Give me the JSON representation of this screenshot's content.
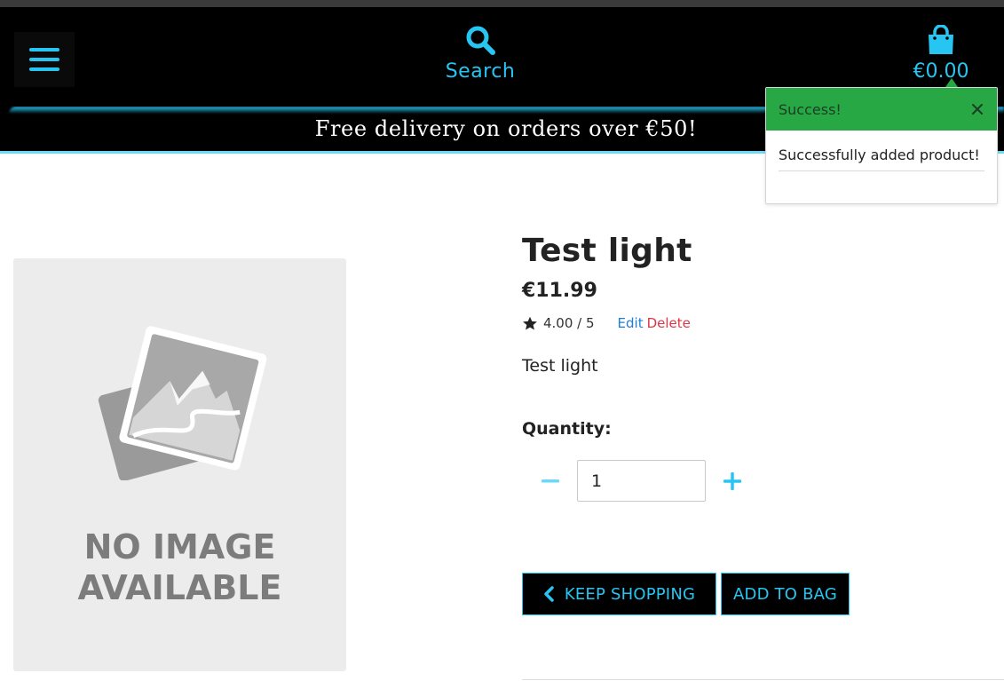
{
  "header": {
    "search_label": "Search",
    "bag_total": "€0.00"
  },
  "banner": {
    "text": "Free delivery on orders over €50!"
  },
  "product": {
    "image_caption_line1": "NO IMAGE",
    "image_caption_line2": "AVAILABLE",
    "title": "Test light",
    "price": "€11.99",
    "rating": "4.00 / 5",
    "edit_label": "Edit",
    "delete_label": "Delete",
    "description": "Test light",
    "quantity_label": "Quantity:",
    "quantity_value": "1"
  },
  "actions": {
    "keep_shopping": "KEEP SHOPPING",
    "add_to_bag": "ADD TO BAG"
  },
  "toast": {
    "title": "Success!",
    "message": "Successfully added product!"
  },
  "colors": {
    "accent": "#27c6f2",
    "success": "#28a745",
    "danger": "#dc3545",
    "link": "#1f7fd6"
  },
  "icons": {
    "menu": "menu-icon",
    "search": "search-icon",
    "bag": "shopping-bag-icon",
    "star": "star-icon",
    "minus": "minus-icon",
    "plus": "plus-icon",
    "chevron": "chevron-left-icon",
    "close": "close-icon"
  }
}
